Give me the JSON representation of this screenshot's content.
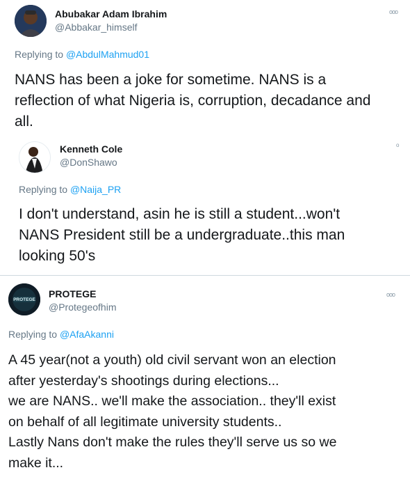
{
  "tweets": [
    {
      "name": "Abubakar Adam Ibrahim",
      "handle": "@Abbakar_himself",
      "replying_prefix": "Replying to ",
      "replying_to": "@AbdulMahmud01",
      "more_icon": "more-icon",
      "text_lines": [
        "NANS has been a joke for sometime. NANS is a",
        "reflection of what Nigeria is, corruption, decadance and",
        "all."
      ]
    },
    {
      "name": "Kenneth Cole",
      "handle": "@DonShawo",
      "replying_prefix": "Replying to ",
      "replying_to": "@Naija_PR",
      "text_lines": [
        "I don't understand, asin he is still a student...won't",
        "NANS President still be a undergraduate..this man",
        "looking 50's"
      ]
    },
    {
      "name": "PROTEGE",
      "handle": "@Protegeofhim",
      "avatar_text": "PROTEGE",
      "replying_prefix": "Replying to ",
      "replying_to": "@AfaAkanni",
      "text_lines": [
        "A 45 year(not a youth) old civil servant won an election",
        "after yesterday's shootings during elections...",
        "we are NANS.. we'll make the association.. they'll exist",
        "on behalf of all legitimate university students..",
        "Lastly Nans don't make the rules they'll serve us so we",
        "make it..."
      ]
    }
  ],
  "colors": {
    "link": "#1da1f2",
    "secondary_text": "#657786",
    "primary_text": "#14171a"
  }
}
